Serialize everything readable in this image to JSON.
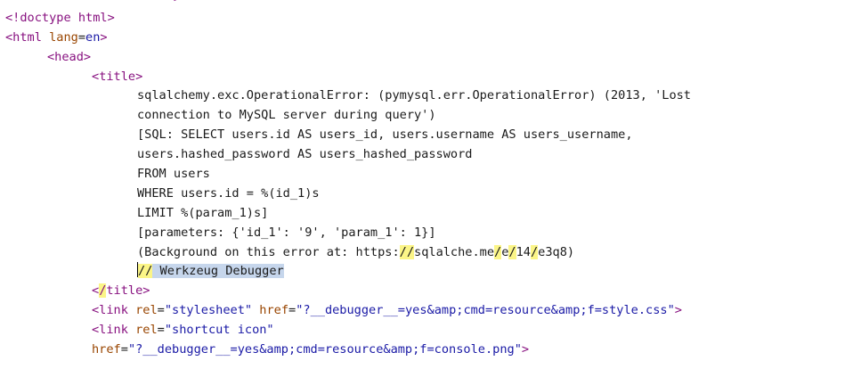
{
  "source": {
    "prev_line_text": "     >",
    "doctype": "<!doctype html>",
    "html_open": "<html",
    "lang_attr": "lang",
    "eq": "=",
    "lang_val": "en",
    "close_bracket": ">",
    "head_open": "<head>",
    "title_prefix": "<",
    "title_tag": "title",
    "title_text": [
      "sqlalchemy.exc.OperationalError: (pymysql.err.OperationalError) (2013, 'Lost",
      "connection to MySQL server during query')",
      "[SQL: SELECT users.id AS users_id, users.username AS users_username,",
      "users.hashed_password AS users_hashed_password",
      "FROM users",
      "WHERE users.id = %(id_1)s",
      "LIMIT %(param_1)s]",
      "[parameters: {'id_1': '9', 'param_1': 1}]"
    ],
    "bg_line": {
      "prefix": "(Background on this error at: https:",
      "slashes": "//",
      "domain": "sqlalche.me",
      "slash": "/",
      "seg1": "e",
      "seg2": "14",
      "suffix": "e3q8)"
    },
    "werkzeug": {
      "slashes": "//",
      "rest": " Werkzeug Debugger"
    },
    "title_close": {
      "lt": "<",
      "slash": "/",
      "name": "title>"
    },
    "link1": {
      "open": "<link",
      "rel_attr": "rel",
      "rel_val": "\"stylesheet\"",
      "href_attr": "href",
      "href_val": "\"?__debugger__=yes&amp;cmd=resource&amp;f=style.css\"",
      "close": ">"
    },
    "link2": {
      "open": "<link",
      "rel_attr": "rel",
      "rel_val": "\"shortcut icon\""
    },
    "link2_href": {
      "href_attr": "href",
      "href_val": "\"?__debugger__=yes&amp;cmd=resource&amp;f=console.png\"",
      "close": ">"
    }
  }
}
